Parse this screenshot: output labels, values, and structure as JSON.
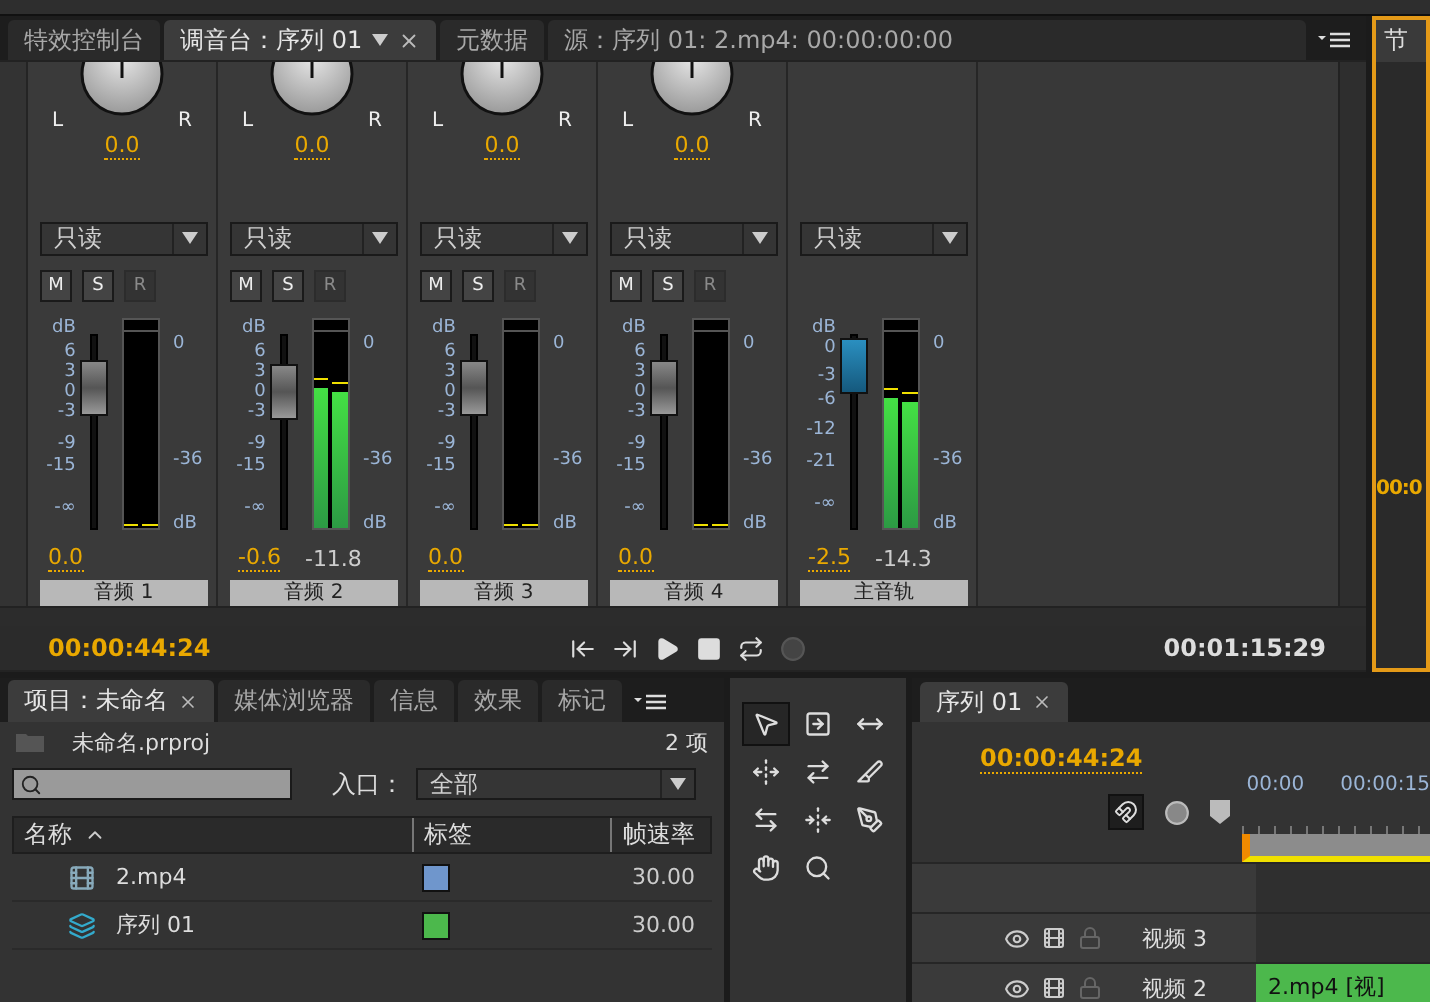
{
  "mixer_panel": {
    "tabs": [
      {
        "label": "特效控制台",
        "selected": false,
        "closable": false,
        "menu": false
      },
      {
        "label": "调音台：序列 01",
        "selected": true,
        "closable": true,
        "menu": true
      },
      {
        "label": "元数据",
        "selected": false,
        "closable": false,
        "menu": false
      },
      {
        "label": "源：序列 01: 2.mp4: 00:00:00:00",
        "selected": false,
        "closable": false,
        "menu": false
      }
    ],
    "channels": [
      {
        "kind": "track",
        "left_label": "L",
        "right_label": "R",
        "pan": "0.0",
        "mode": "只读",
        "buttons": [
          {
            "label": "M",
            "disabled": false
          },
          {
            "label": "S",
            "disabled": false
          },
          {
            "label": "R",
            "disabled": true
          }
        ],
        "scale": [
          "dB",
          "6",
          "3",
          "0",
          "-3",
          "-9",
          "-15",
          "-∞"
        ],
        "fader": {
          "level": 0.72
        },
        "meters": [
          {
            "level": 0
          },
          {
            "level": 0
          }
        ],
        "meter_scale": [
          "0",
          "-36",
          "dB"
        ],
        "volume": "0.0",
        "name": "音频 1"
      },
      {
        "kind": "track",
        "left_label": "L",
        "right_label": "R",
        "pan": "0.0",
        "mode": "只读",
        "buttons": [
          {
            "label": "M",
            "disabled": false
          },
          {
            "label": "S",
            "disabled": false
          },
          {
            "label": "R",
            "disabled": true
          }
        ],
        "scale": [
          "dB",
          "6",
          "3",
          "0",
          "-3",
          "-9",
          "-15",
          "-∞"
        ],
        "fader": {
          "level": 0.7
        },
        "meters": [
          {
            "level": 0.71
          },
          {
            "level": 0.69
          }
        ],
        "meter_scale": [
          "0",
          "-36",
          "dB"
        ],
        "volume": "-0.6",
        "peak": "-11.8",
        "name": "音频 2"
      },
      {
        "kind": "track",
        "left_label": "L",
        "right_label": "R",
        "pan": "0.0",
        "mode": "只读",
        "buttons": [
          {
            "label": "M",
            "disabled": false
          },
          {
            "label": "S",
            "disabled": false
          },
          {
            "label": "R",
            "disabled": true
          }
        ],
        "scale": [
          "dB",
          "6",
          "3",
          "0",
          "-3",
          "-9",
          "-15",
          "-∞"
        ],
        "fader": {
          "level": 0.72
        },
        "meters": [
          {
            "level": 0
          },
          {
            "level": 0
          }
        ],
        "meter_scale": [
          "0",
          "-36",
          "dB"
        ],
        "volume": "0.0",
        "name": "音频 3"
      },
      {
        "kind": "track",
        "left_label": "L",
        "right_label": "R",
        "pan": "0.0",
        "mode": "只读",
        "buttons": [
          {
            "label": "M",
            "disabled": false
          },
          {
            "label": "S",
            "disabled": false
          },
          {
            "label": "R",
            "disabled": true
          }
        ],
        "scale": [
          "dB",
          "6",
          "3",
          "0",
          "-3",
          "-9",
          "-15",
          "-∞"
        ],
        "fader": {
          "level": 0.72
        },
        "meters": [
          {
            "level": 0
          },
          {
            "level": 0
          }
        ],
        "meter_scale": [
          "0",
          "-36",
          "dB"
        ],
        "volume": "0.0",
        "name": "音频 4"
      },
      {
        "kind": "master",
        "mode": "只读",
        "scale": [
          "dB",
          "0",
          "-3",
          "-6",
          "-12",
          "-21",
          "-∞"
        ],
        "fader": {
          "level": 0.84
        },
        "meters": [
          {
            "level": 0.66
          },
          {
            "level": 0.64
          }
        ],
        "meter_scale": [
          "0",
          "-36",
          "dB"
        ],
        "volume": "-2.5",
        "peak": "-14.3",
        "name": "主音轨"
      }
    ],
    "transport": {
      "current": "00:00:44:24",
      "duration": "00:01:15:29",
      "controls": [
        {
          "kind": "go-in"
        },
        {
          "kind": "go-out"
        },
        {
          "kind": "play"
        },
        {
          "kind": "stop"
        },
        {
          "kind": "loop"
        },
        {
          "kind": "record"
        }
      ]
    }
  },
  "right_panel": {
    "tab": "节",
    "timecode": "00:0"
  },
  "project_panel": {
    "tabs": [
      {
        "label": "项目：未命名",
        "selected": true,
        "closable": true
      },
      {
        "label": "媒体浏览器",
        "selected": false,
        "closable": false
      },
      {
        "label": "信息",
        "selected": false,
        "closable": false
      },
      {
        "label": "效果",
        "selected": false,
        "closable": false
      },
      {
        "label": "标记",
        "selected": false,
        "closable": false
      }
    ],
    "file": "未命名.prproj",
    "count": "2 项",
    "filter": {
      "label": "入口：",
      "value": "全部"
    },
    "columns": [
      "名称",
      "标签",
      "帧速率"
    ],
    "rows": [
      {
        "kind": "clip",
        "name": "2.mp4",
        "color": "#6f96cc",
        "fps": "30.00"
      },
      {
        "kind": "sequence",
        "name": "序列 01",
        "color": "#4cb84c",
        "fps": "30.00"
      }
    ]
  },
  "tools": [
    {
      "kind": "select",
      "selected": true
    },
    {
      "kind": "track-select",
      "selected": false
    },
    {
      "kind": "ripple",
      "selected": false
    },
    {
      "kind": "rolling",
      "selected": false
    },
    {
      "kind": "rate",
      "selected": false
    },
    {
      "kind": "razor",
      "selected": false
    },
    {
      "kind": "slip",
      "selected": false
    },
    {
      "kind": "slide",
      "selected": false
    },
    {
      "kind": "pen",
      "selected": false
    },
    {
      "kind": "hand",
      "selected": false
    },
    {
      "kind": "zoom",
      "selected": false
    }
  ],
  "timeline": {
    "tab": {
      "label": "序列 01",
      "selected": true
    },
    "timecode": "00:00:44:24",
    "snap": {
      "on": true
    },
    "ruler": [
      "00:00",
      "00:00:15"
    ],
    "tracks": [
      {
        "name": "视频 3"
      },
      {
        "name": "视频 2",
        "clip": "2.mp4 [视]"
      }
    ]
  }
}
